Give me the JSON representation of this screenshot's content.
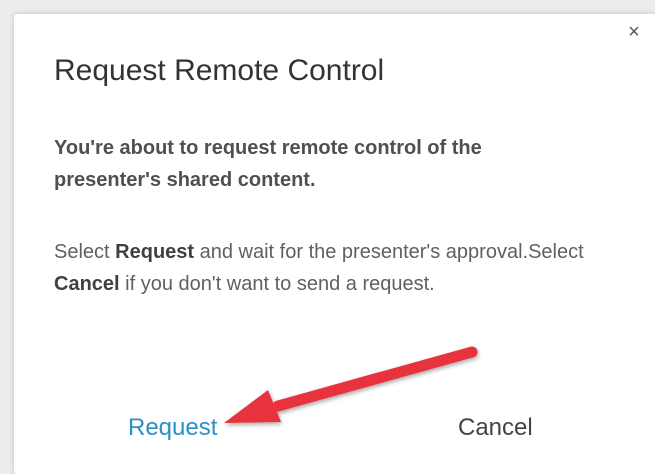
{
  "dialog": {
    "close_glyph": "×",
    "title": "Request Remote Control",
    "lead": "You're about to request remote control of the presenter's shared content.",
    "body": {
      "select_1": "Select ",
      "request_word": "Request",
      "mid_1": " and wait for the presenter's approval.Select ",
      "cancel_word": "Cancel",
      "mid_2": " if you don't want to send a request."
    },
    "buttons": {
      "request_label": "Request",
      "cancel_label": "Cancel"
    }
  },
  "annotation": {
    "arrow_color": "#e8323c"
  },
  "colors": {
    "accent": "#2b8fc9"
  }
}
